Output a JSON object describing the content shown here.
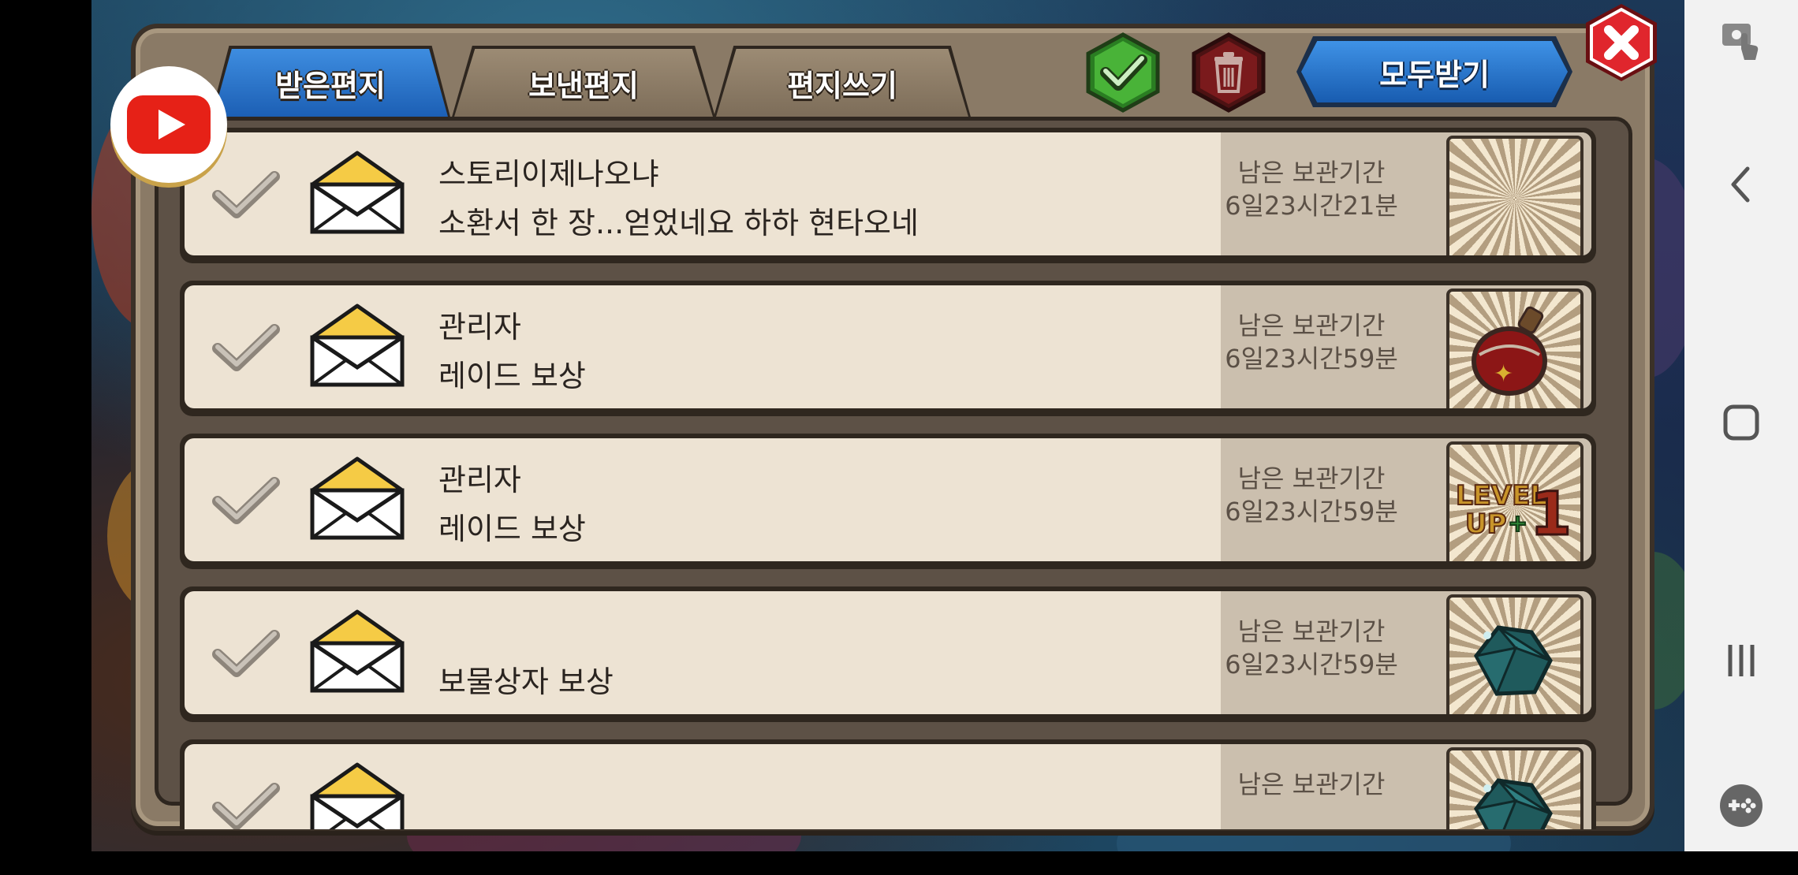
{
  "tabs": [
    {
      "label": "받은편지",
      "active": true
    },
    {
      "label": "보낸편지",
      "active": false
    },
    {
      "label": "편지쓰기",
      "active": false
    }
  ],
  "header": {
    "receive_all_label": "모두받기",
    "check_icon": "check-icon",
    "trash_icon": "trash-icon",
    "close_icon": "close-icon"
  },
  "mail": [
    {
      "sender": "스토리이제나오냐",
      "message": "소환서 한 장...얻었네요 하하 현타오네",
      "period_label": "남은 보관기간",
      "period_value": "6일23시간21분",
      "reward_icon": "sunburst-reward-icon"
    },
    {
      "sender": "관리자",
      "message": "레이드 보상",
      "period_label": "남은 보관기간",
      "period_value": "6일23시간59분",
      "reward_icon": "potion-icon"
    },
    {
      "sender": "관리자",
      "message": "레이드 보상",
      "period_label": "남은 보관기간",
      "period_value": "6일23시간59분",
      "reward_icon": "level-up-icon"
    },
    {
      "sender": "",
      "message": "보물상자 보상",
      "period_label": "남은 보관기간",
      "period_value": "6일23시간59분",
      "reward_icon": "ore-icon"
    },
    {
      "sender": "",
      "message": "",
      "period_label": "남은 보관기간",
      "period_value": "",
      "reward_icon": "ore-icon"
    }
  ],
  "level_up_text": "LEVEL UP+1",
  "colors": {
    "tab_active": "#2a76d2",
    "receive_button": "#1f6cc6",
    "close_button": "#d9222a",
    "check_button": "#2fa12f",
    "trash_button": "#7a1a1c"
  }
}
